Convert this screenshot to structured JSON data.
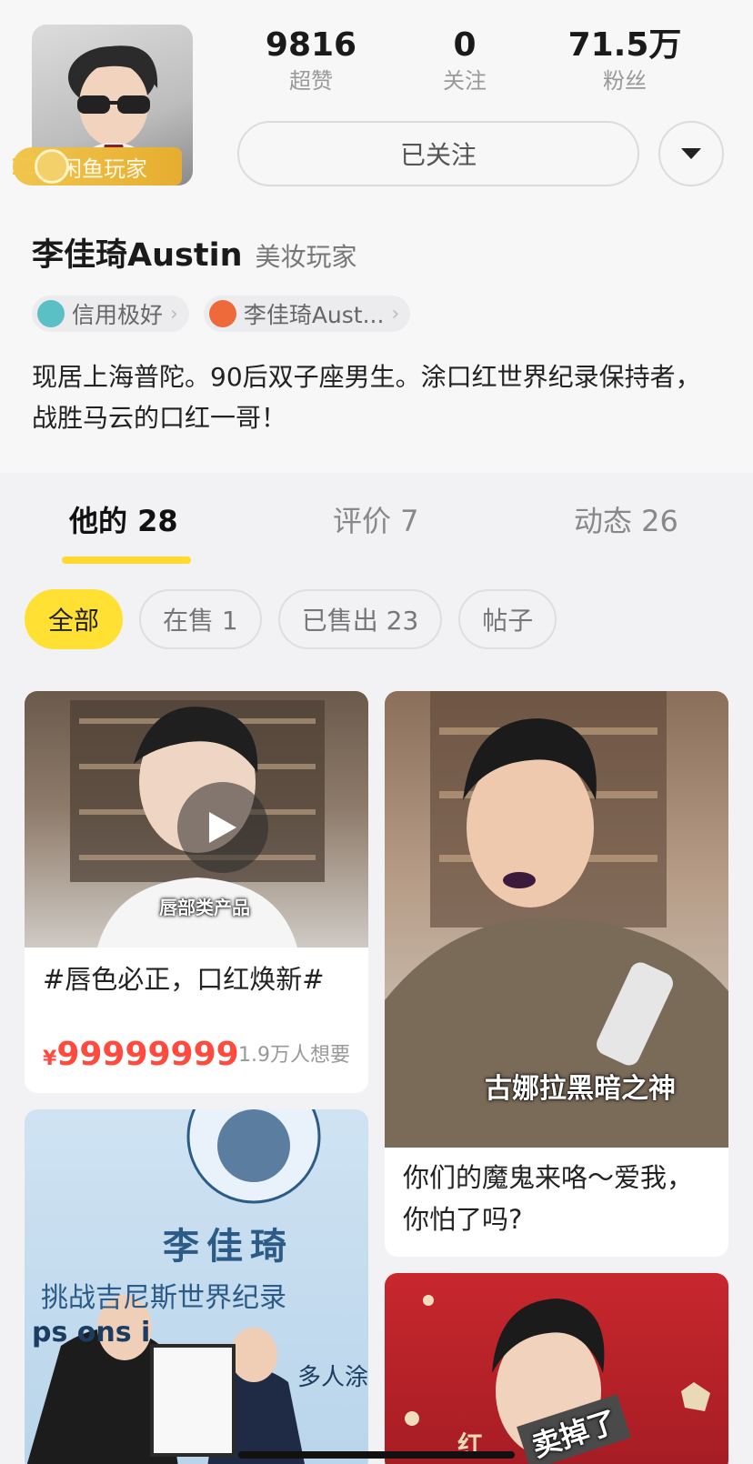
{
  "profile": {
    "badge_label": "闲鱼玩家",
    "name": "李佳琦Austin",
    "role": "美妆玩家",
    "tags": [
      {
        "label": "信用极好",
        "icon": "credit-icon"
      },
      {
        "label": "李佳琦Aust...",
        "icon": "weibo-icon"
      }
    ],
    "bio": "现居上海普陀。90后双子座男生。涂口红世界纪录保持者，战胜马云的口红一哥！"
  },
  "stats": [
    {
      "value": "9816",
      "label": "超赞"
    },
    {
      "value": "0",
      "label": "关注"
    },
    {
      "value": "71.5万",
      "label": "粉丝"
    }
  ],
  "follow_button": "已关注",
  "tabs": [
    {
      "label": "他的 28",
      "active": true
    },
    {
      "label": "评价 7",
      "active": false
    },
    {
      "label": "动态 26",
      "active": false
    }
  ],
  "filters": [
    {
      "label": "全部",
      "active": true
    },
    {
      "label": "在售 1",
      "active": false
    },
    {
      "label": "已售出 23",
      "active": false
    },
    {
      "label": "帖子",
      "active": false
    }
  ],
  "cards": [
    {
      "title": "#唇色必正，口红焕新#",
      "currency": "¥",
      "price": "99999999",
      "want": "1.9万人想要",
      "image_caption": "唇部类产品"
    },
    {
      "title": "你们的魔鬼来咯～爱我，你怕了吗?",
      "image_caption": "古娜拉黑暗之神"
    },
    {
      "image_title": "李佳琦",
      "image_subtitle": "挑战吉尼斯世界纪录",
      "image_line": "ps ons i",
      "image_line2": "多人涂"
    },
    {
      "image_caption": "卖掉了",
      "image_badge": "红"
    }
  ],
  "colors": {
    "accent_yellow": "#ffe033",
    "price_red": "#ff4a3d",
    "badge_gold": "#e9b237"
  }
}
